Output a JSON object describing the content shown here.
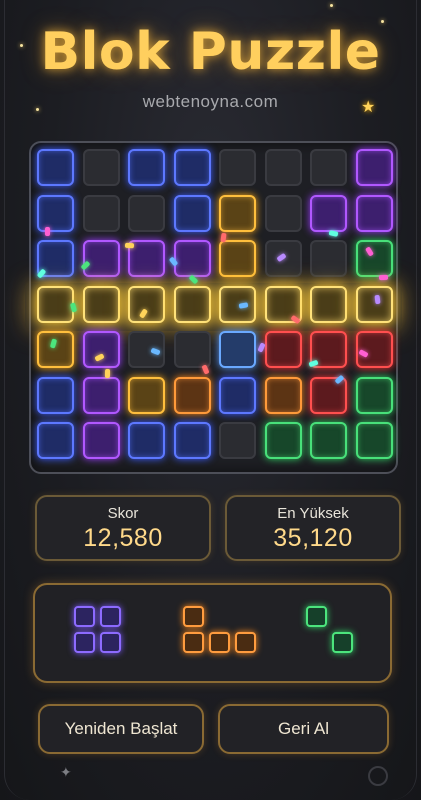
{
  "header": {
    "title": "Blok Puzzle",
    "subtitle": "webtenoyna.com"
  },
  "board": {
    "rows": 7,
    "cols": 8,
    "cleared_row": 3,
    "cells": [
      [
        "blue",
        "empty",
        "blue",
        "blue",
        "empty",
        "empty",
        "empty",
        "purple"
      ],
      [
        "blue",
        "empty",
        "empty",
        "blue",
        "gold",
        "empty",
        "purple",
        "purple"
      ],
      [
        "blue",
        "purple",
        "purple",
        "purple",
        "gold",
        "empty",
        "empty",
        "green"
      ],
      [
        "glow",
        "glow",
        "glow",
        "glow",
        "glow",
        "glow",
        "glow",
        "glow"
      ],
      [
        "gold",
        "purple",
        "empty",
        "empty",
        "lightblue",
        "red",
        "red",
        "red"
      ],
      [
        "blue",
        "purple",
        "gold",
        "orange",
        "blue",
        "orange",
        "red",
        "green"
      ],
      [
        "blue",
        "purple",
        "blue",
        "blue",
        "empty",
        "green",
        "green",
        "green"
      ]
    ]
  },
  "scores": {
    "score_label": "Skor",
    "score_value": "12,580",
    "best_label": "En Yüksek",
    "best_value": "35,120"
  },
  "pieces": [
    {
      "name": "square",
      "color": "purple",
      "cells": [
        [
          0,
          0
        ],
        [
          1,
          0
        ],
        [
          0,
          1
        ],
        [
          1,
          1
        ]
      ]
    },
    {
      "name": "l-shape",
      "color": "orange",
      "cells": [
        [
          0,
          0
        ],
        [
          0,
          1
        ],
        [
          1,
          1
        ],
        [
          2,
          1
        ]
      ]
    },
    {
      "name": "diagonal",
      "color": "green",
      "cells": [
        [
          0,
          0
        ],
        [
          1,
          1
        ]
      ]
    }
  ],
  "buttons": {
    "restart_label": "Yeniden Başlat",
    "undo_label": "Geri Al"
  },
  "colors": {
    "title": "#ffcf5e",
    "blue": "#5d78ff",
    "purple": "#b158ff",
    "gold": "#ffbf3d",
    "orange": "#ff9a3a",
    "red": "#ff4f4f",
    "green": "#48e07a"
  }
}
